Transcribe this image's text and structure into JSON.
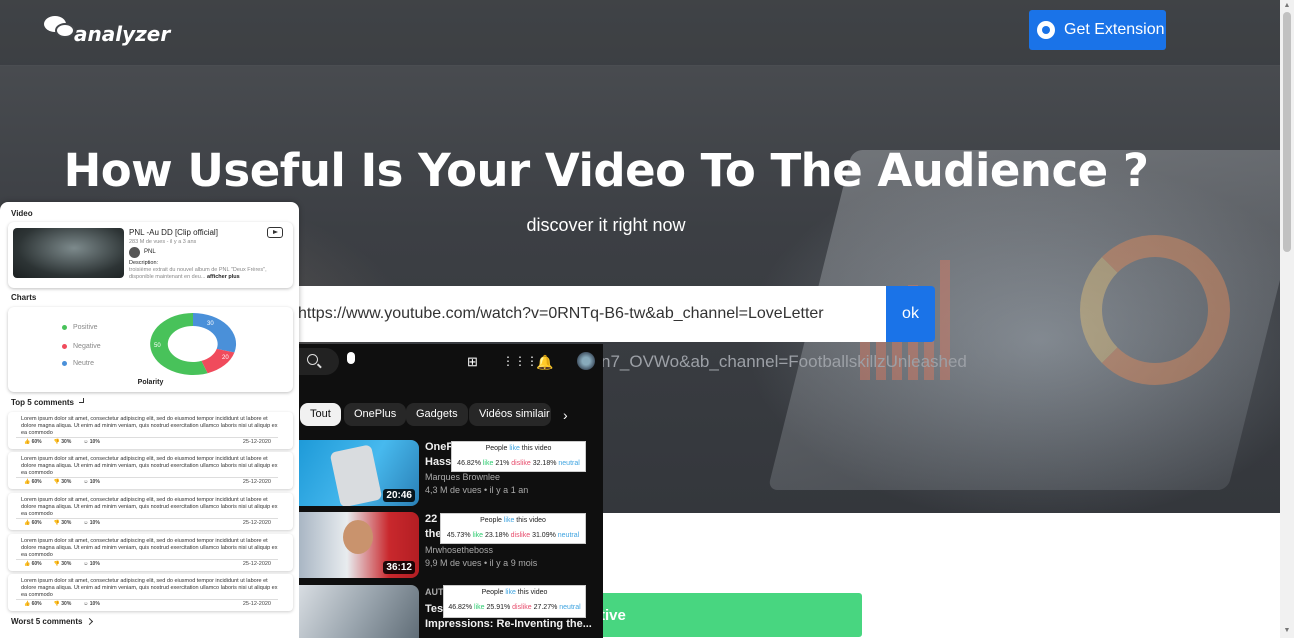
{
  "header": {
    "logo_text": "analyzer",
    "extension_button": "Get Extension"
  },
  "hero": {
    "headline": "How Useful Is Your Video To The Audience ?",
    "subline": "discover it right now",
    "url_value": "https://www.youtube.com/watch?v=0RNTq-B6-tw&ab_channel=LoveLetter",
    "ok_label": "ok",
    "second_url": "n7_OVWo&ab_channel=FootballskillzUnleashed"
  },
  "action_button": "tive",
  "colors": {
    "accent": "#1a73e8",
    "positive": "#48d680",
    "negative": "#f04b5c",
    "neutral": "#4a90d9"
  },
  "extension_mock": {
    "video_label": "Video",
    "video": {
      "title": "PNL -Au DD [Clip official]",
      "meta": "283 M de vues - il y a 3 ans",
      "channel": "PNL",
      "desc_label": "Description:",
      "desc": "troisième extrait du nouvel album de PNL \"Deux Frères\", disponible maintenant en deu...",
      "more": "afficher plus"
    },
    "charts_label": "Charts",
    "legend": [
      "Positive",
      "Negative",
      "Neutre"
    ],
    "donut_labels": {
      "positive": "50",
      "negative": "20",
      "neutral": "30"
    },
    "chart_title": "Polarity",
    "top_label": "Top 5 comments",
    "comments": [
      {
        "text": "Lorem ipsum dolor sit amet, consectetur adipiscing elit, sed do eiusmod tempor incididunt ut labore et dolore magna aliqua. Ut enim ad minim veniam, quis nostrud exercitation ullamco laboris nisi ut aliquip ex ea commodo",
        "like": "60%",
        "dislike": "30%",
        "neutral": "10%",
        "date": "25-12-2020"
      },
      {
        "text": "Lorem ipsum dolor sit amet, consectetur adipiscing elit, sed do eiusmod tempor incididunt ut labore et dolore magna aliqua. Ut enim ad minim veniam, quis nostrud exercitation ullamco laboris nisi ut aliquip ex ea commodo",
        "like": "60%",
        "dislike": "30%",
        "neutral": "10%",
        "date": "25-12-2020"
      },
      {
        "text": "Lorem ipsum dolor sit amet, consectetur adipiscing elit, sed do eiusmod tempor incididunt ut labore et dolore magna aliqua. Ut enim ad minim veniam, quis nostrud exercitation ullamco laboris nisi ut aliquip ex ea commodo",
        "like": "60%",
        "dislike": "30%",
        "neutral": "10%",
        "date": "25-12-2020"
      },
      {
        "text": "Lorem ipsum dolor sit amet, consectetur adipiscing elit, sed do eiusmod tempor incididunt ut labore et dolore magna aliqua. Ut enim ad minim veniam, quis nostrud exercitation ullamco laboris nisi ut aliquip ex ea commodo",
        "like": "60%",
        "dislike": "30%",
        "neutral": "10%",
        "date": "25-12-2020"
      },
      {
        "text": "Lorem ipsum dolor sit amet, consectetur adipiscing elit, sed do eiusmod tempor incididunt ut labore et dolore magna aliqua. Ut enim ad minim veniam, quis nostrud exercitation ullamco laboris nisi ut aliquip ex ea commodo",
        "like": "60%",
        "dislike": "30%",
        "neutral": "10%",
        "date": "25-12-2020"
      }
    ],
    "worst_label": "Worst 5 comments"
  },
  "youtube_mock": {
    "chips": [
      "Tout",
      "OnePlus",
      "Gadgets",
      "Vidéos similair"
    ],
    "videos": [
      {
        "title1": "OneP",
        "title2": "Hass",
        "channel": "Marques Brownlee",
        "meta": "4,3 M de vues • il y a 1 an",
        "duration": "20:46",
        "popup": {
          "title_pre": "People ",
          "title_like": "like",
          "title_post": " this video",
          "like": "46.82%",
          "like_w": " like",
          "dislike": "21%",
          "dislike_w": " dislike",
          "neutral": "32.18%",
          "neutral_w": " neutral"
        }
      },
      {
        "title1": "22 M",
        "title2": "they",
        "channel": "Mrwhosetheboss",
        "meta": "9,9 M de vues • il y a 9 mois",
        "duration": "36:12",
        "popup": {
          "title_pre": "People ",
          "title_like": "like",
          "title_post": " this video",
          "like": "45.73%",
          "like_w": " like",
          "dislike": "23.18%",
          "dislike_w": " dislike",
          "neutral": "31.09%",
          "neutral_w": " neutral"
        }
      },
      {
        "title1": "AUTO",
        "title2": "Tes",
        "title3": "Impressions: Re-Inventing the...",
        "popup": {
          "title_pre": "People ",
          "title_like": "like",
          "title_post": " this video",
          "like": "46.82%",
          "like_w": " like",
          "dislike": "25.91%",
          "dislike_w": " dislike",
          "neutral": "27.27%",
          "neutral_w": " neutral"
        }
      }
    ]
  }
}
